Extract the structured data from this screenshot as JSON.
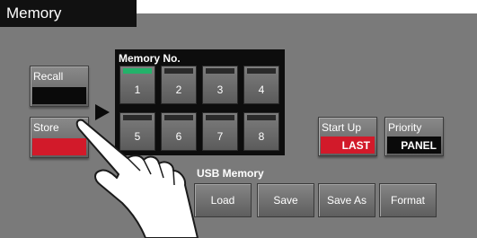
{
  "title": "Memory",
  "recall": {
    "label": "Recall"
  },
  "store": {
    "label": "Store"
  },
  "memory": {
    "header": "Memory No.",
    "slots": [
      "1",
      "2",
      "3",
      "4",
      "5",
      "6",
      "7",
      "8"
    ],
    "selected": "1"
  },
  "startup": {
    "label": "Start Up",
    "value": "LAST"
  },
  "priority": {
    "label": "Priority",
    "value": "PANEL"
  },
  "usb": {
    "label": "USB Memory",
    "buttons": [
      "Load",
      "Save",
      "Save As",
      "Format"
    ]
  },
  "colors": {
    "background": "#7a7a7a",
    "indicator_red": "#d21a2a",
    "selected_led": "#23b26a"
  }
}
